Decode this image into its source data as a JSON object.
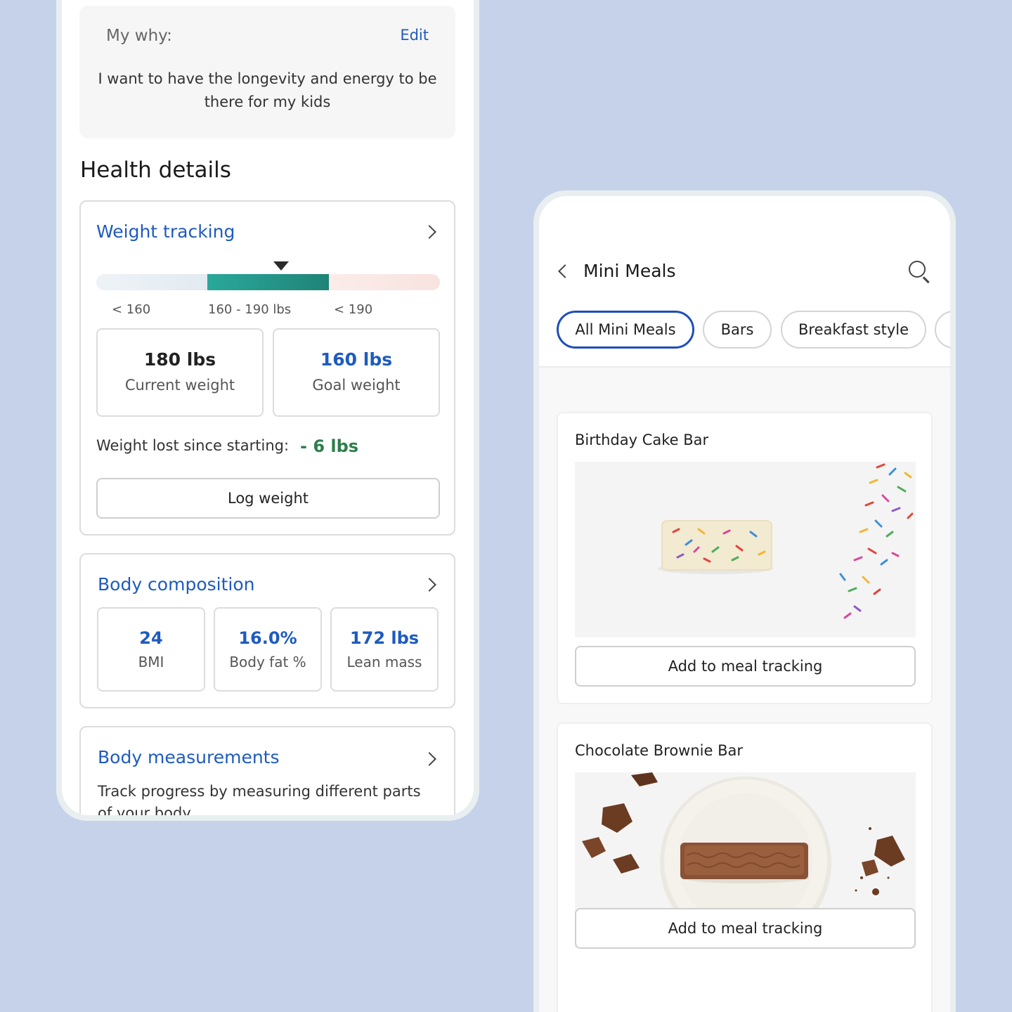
{
  "why": {
    "title": "My why:",
    "edit_label": "Edit",
    "text": "I want to have the longevity and energy to be there for my kids"
  },
  "health": {
    "title": "Health details",
    "weight_tracking": {
      "title": "Weight tracking",
      "range_labels": [
        "< 160",
        "160 - 190 lbs",
        "< 190"
      ],
      "current_value": "180 lbs",
      "current_label": "Current weight",
      "goal_value": "160 lbs",
      "goal_label": "Goal weight",
      "lost_label": "Weight lost since starting:",
      "lost_value": "- 6 lbs",
      "log_button": "Log weight"
    },
    "body_composition": {
      "title": "Body composition",
      "stats": [
        {
          "value": "24",
          "label": "BMI"
        },
        {
          "value": "16.0%",
          "label": "Body fat %"
        },
        {
          "value": "172 lbs",
          "label": "Lean mass"
        }
      ]
    },
    "body_measurements": {
      "title": "Body measurements",
      "text": "Track progress by measuring different parts of your body"
    }
  },
  "meals": {
    "title": "Mini Meals",
    "chips": [
      "All Mini Meals",
      "Bars",
      "Breakfast style"
    ],
    "items": [
      {
        "name": "Birthday Cake Bar",
        "button": "Add to meal tracking"
      },
      {
        "name": "Chocolate Brownie Bar",
        "button": "Add to meal tracking"
      }
    ]
  },
  "colors": {
    "background": "#c5d2e9",
    "accent_blue": "#1e5bbf",
    "chip_active": "#1e4fb8",
    "range_mid": "#1f8477",
    "success_green": "#2e7d4b"
  },
  "icons": [
    "chevron-right-icon",
    "chevron-left-icon",
    "search-icon",
    "range-marker-icon"
  ]
}
